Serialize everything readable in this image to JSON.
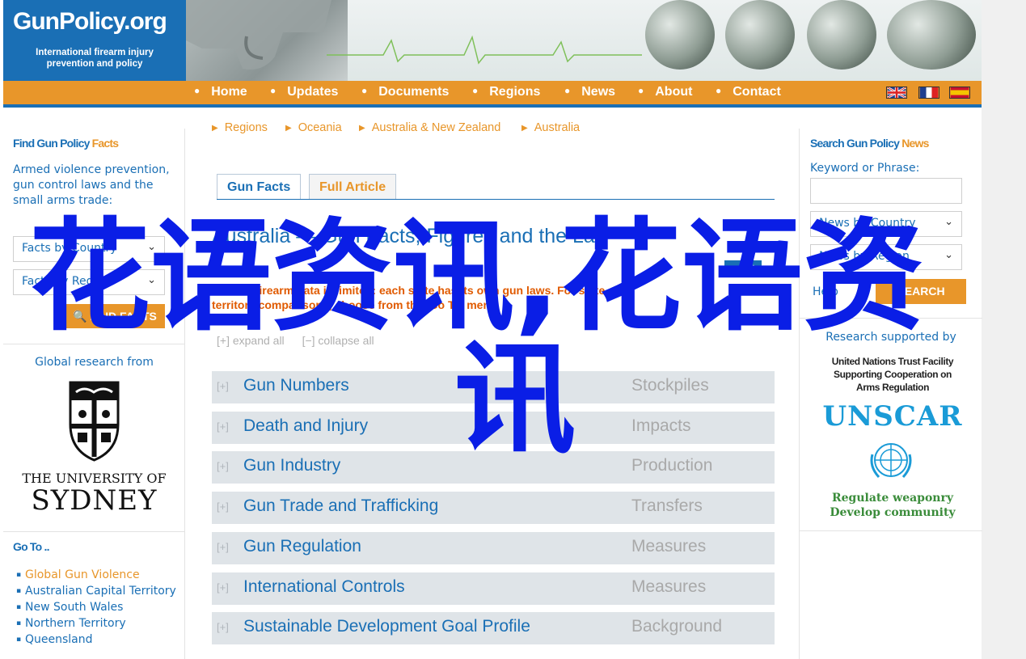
{
  "header": {
    "logo_title": "GunPolicy.org",
    "logo_tagline_1": "International firearm injury",
    "logo_tagline_2": "prevention and policy"
  },
  "nav": {
    "items": [
      "Home",
      "Updates",
      "Documents",
      "Regions",
      "News",
      "About",
      "Contact"
    ],
    "flags": [
      "uk-flag-icon",
      "france-flag-icon",
      "spain-flag-icon"
    ]
  },
  "left": {
    "find_head_1": "Find Gun Policy",
    "find_head_2": "Facts",
    "find_text": "Armed violence prevention, gun control laws and the small arms trade:",
    "select_country": "Facts by Country",
    "select_region": "Facts by Region",
    "find_button": "FIND FACTS",
    "research_label": "Global research from",
    "uni_line1": "THE UNIVERSITY OF",
    "uni_line2": "SYDNEY",
    "goto_head": "Go To ..",
    "goto_items": [
      "Global Gun Violence",
      "Australian Capital Territory",
      "New South Wales",
      "Northern Territory",
      "Queensland"
    ]
  },
  "breadcrumbs": [
    "Regions",
    "Oceania",
    "Australia & New Zealand",
    "Australia"
  ],
  "tabs": {
    "gun_facts": "Gun Facts",
    "full_article": "Full Article"
  },
  "main": {
    "title": "Australia — Gun Facts, Figures and the Law",
    "subtitle": "Federal firearm data is limited: each state has its own gun laws. For state and territory comparisons, choose from the 'Go To' menu",
    "expand_all": "[+] expand all",
    "collapse_all": "[−] collapse all",
    "sections": [
      {
        "title": "Gun Numbers",
        "category": "Stockpiles"
      },
      {
        "title": "Death and Injury",
        "category": "Impacts"
      },
      {
        "title": "Gun Industry",
        "category": "Production"
      },
      {
        "title": "Gun Trade and Trafficking",
        "category": "Transfers"
      },
      {
        "title": "Gun Regulation",
        "category": "Measures"
      },
      {
        "title": "International Controls",
        "category": "Measures"
      },
      {
        "title": "Sustainable Development Goal Profile",
        "category": "Background"
      }
    ]
  },
  "right": {
    "news_head_1": "Search Gun Policy",
    "news_head_2": "News",
    "keyword_label": "Keyword or Phrase:",
    "select_country": "News by Country",
    "select_region": "News by Region",
    "help": "Help",
    "search_button": "SEARCH",
    "research_label": "Research supported by",
    "unscar_line1": "United Nations Trust Facility",
    "unscar_line2": "Supporting Cooperation on",
    "unscar_line3": "Arms Regulation",
    "unscar_logo": "UNSCAR",
    "unscar_tag1": "Regulate weaponry",
    "unscar_tag2": "Develop community"
  },
  "watermark": {
    "line1": "花语资讯,花语资",
    "line2": "讯"
  },
  "colors": {
    "brand_blue": "#1a6fb5",
    "brand_orange": "#e8962a",
    "watermark": "#0a1ee6"
  }
}
